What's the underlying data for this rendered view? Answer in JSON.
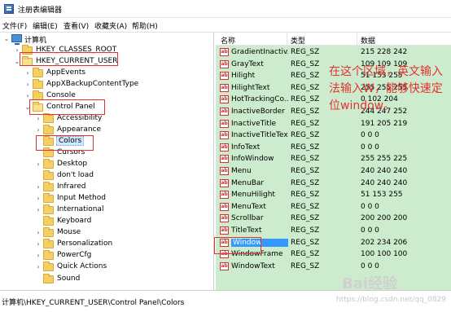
{
  "window": {
    "title": "注册表编辑器"
  },
  "menubar": {
    "items": [
      "文件(F)",
      "编辑(E)",
      "查看(V)",
      "收藏夹(A)",
      "帮助(H)"
    ]
  },
  "tree": {
    "root": "计算机",
    "items": [
      {
        "label": "HKEY_CLASSES_ROOT"
      },
      {
        "label": "HKEY_CURRENT_USER"
      },
      {
        "label": "AppEvents"
      },
      {
        "label": "AppXBackupContentType"
      },
      {
        "label": "Console"
      },
      {
        "label": "Control Panel"
      },
      {
        "label": "Accessibility"
      },
      {
        "label": "Appearance"
      },
      {
        "label": "Colors"
      },
      {
        "label": "Cursors"
      },
      {
        "label": "Desktop"
      },
      {
        "label": "don't load"
      },
      {
        "label": "Infrared"
      },
      {
        "label": "Input Method"
      },
      {
        "label": "International"
      },
      {
        "label": "Keyboard"
      },
      {
        "label": "Mouse"
      },
      {
        "label": "Personalization"
      },
      {
        "label": "PowerCfg"
      },
      {
        "label": "Quick Actions"
      },
      {
        "label": "Sound"
      }
    ]
  },
  "list": {
    "headers": {
      "name": "名称",
      "type": "类型",
      "data": "数据"
    },
    "rows": [
      {
        "name": "GradientInactiv...",
        "type": "REG_SZ",
        "data": "215 228 242"
      },
      {
        "name": "GrayText",
        "type": "REG_SZ",
        "data": "109 109 109"
      },
      {
        "name": "Hilight",
        "type": "REG_SZ",
        "data": "51 153 255"
      },
      {
        "name": "HilightText",
        "type": "REG_SZ",
        "data": "255 255 255"
      },
      {
        "name": "HotTrackingCo...",
        "type": "REG_SZ",
        "data": "0 102 204"
      },
      {
        "name": "InactiveBorder",
        "type": "REG_SZ",
        "data": "244 247 252"
      },
      {
        "name": "InactiveTitle",
        "type": "REG_SZ",
        "data": "191 205 219"
      },
      {
        "name": "InactiveTitleText",
        "type": "REG_SZ",
        "data": "0 0 0"
      },
      {
        "name": "InfoText",
        "type": "REG_SZ",
        "data": "0 0 0"
      },
      {
        "name": "InfoWindow",
        "type": "REG_SZ",
        "data": "255 255 225"
      },
      {
        "name": "Menu",
        "type": "REG_SZ",
        "data": "240 240 240"
      },
      {
        "name": "MenuBar",
        "type": "REG_SZ",
        "data": "240 240 240"
      },
      {
        "name": "MenuHilight",
        "type": "REG_SZ",
        "data": "51 153 255"
      },
      {
        "name": "MenuText",
        "type": "REG_SZ",
        "data": "0 0 0"
      },
      {
        "name": "Scrollbar",
        "type": "REG_SZ",
        "data": "200 200 200"
      },
      {
        "name": "TitleText",
        "type": "REG_SZ",
        "data": "0 0 0"
      },
      {
        "name": "Window",
        "type": "REG_SZ",
        "data": "202 234 206"
      },
      {
        "name": "WindowFrame",
        "type": "REG_SZ",
        "data": "100 100 100"
      },
      {
        "name": "WindowText",
        "type": "REG_SZ",
        "data": "0 0 0"
      }
    ]
  },
  "statusbar": {
    "path": "计算机\\HKEY_CURRENT_USER\\Control Panel\\Colors"
  },
  "watermark": {
    "url": "https://blog.csdn.net/qq_0829",
    "logo": "Bai经验"
  },
  "annotation": {
    "text": "在这个区域，英文输入法输入W，能够快速定位window。"
  },
  "colors": {
    "list_bg": "#cdeccd",
    "highlight_box": "#e8302a",
    "annotation": "#e23232",
    "selection": "#3399ff"
  }
}
